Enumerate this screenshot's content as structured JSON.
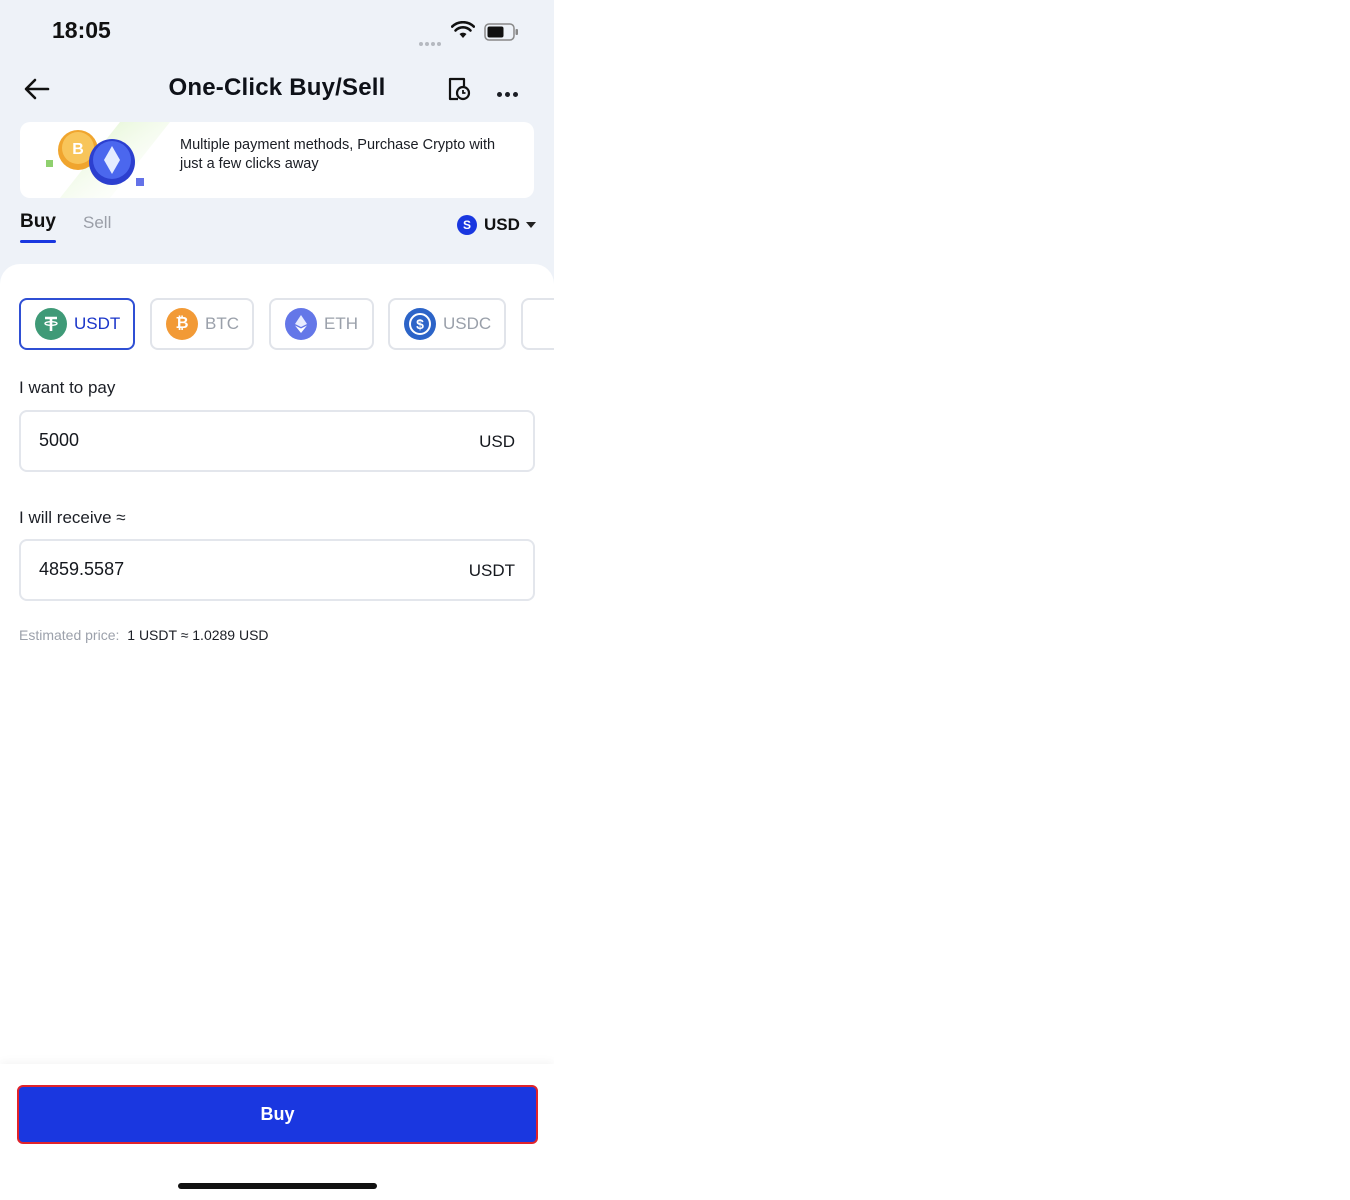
{
  "status_bar": {
    "time": "18:05"
  },
  "header": {
    "title": "One-Click Buy/Sell"
  },
  "banner": {
    "text": "Multiple payment methods, Purchase Crypto with just a few clicks away"
  },
  "tabs": [
    {
      "label": "Buy",
      "active": true
    },
    {
      "label": "Sell",
      "active": false
    }
  ],
  "fiat_select": {
    "badge": "S",
    "label": "USD"
  },
  "coins": [
    {
      "label": "USDT",
      "active": true,
      "color": "#3f9a77",
      "glyph": "T"
    },
    {
      "label": "BTC",
      "active": false,
      "color": "#f29a36",
      "glyph": "B"
    },
    {
      "label": "ETH",
      "active": false,
      "color": "#6477e8",
      "glyph": "◆"
    },
    {
      "label": "USDC",
      "active": false,
      "color": "#2c64c8",
      "glyph": "$"
    }
  ],
  "pay": {
    "label": "I want to pay",
    "value": "5000",
    "unit": "USD"
  },
  "receive": {
    "label": "I will receive ≈",
    "value": "4859.5587",
    "unit": "USDT"
  },
  "estimate": {
    "label": "Estimated price:",
    "value": "1 USDT ≈ 1.0289 USD"
  },
  "buy_button": {
    "label": "Buy"
  },
  "colors": {
    "accent": "#1a37e0",
    "highlight_border": "#e0232b",
    "background": "#eef2f8"
  }
}
